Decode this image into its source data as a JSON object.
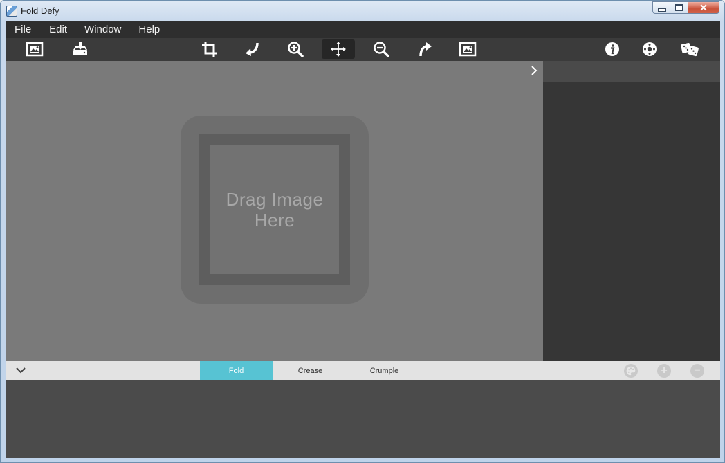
{
  "window": {
    "title": "Fold Defy",
    "close_glyph": "✕"
  },
  "menu": {
    "items": [
      "File",
      "Edit",
      "Window",
      "Help"
    ]
  },
  "toolbar": {
    "left": [
      {
        "name": "open-image-icon"
      },
      {
        "name": "save-download-icon"
      }
    ],
    "center": [
      {
        "name": "crop-icon"
      },
      {
        "name": "rotate-left-icon"
      },
      {
        "name": "zoom-in-icon"
      },
      {
        "name": "move-icon",
        "active": true
      },
      {
        "name": "zoom-out-icon"
      },
      {
        "name": "redo-icon"
      },
      {
        "name": "fit-image-icon"
      }
    ],
    "right": [
      {
        "name": "info-icon"
      },
      {
        "name": "settings-icon"
      },
      {
        "name": "random-dice-icon"
      }
    ]
  },
  "canvas": {
    "drop_hint": "Drag Image Here"
  },
  "tabs": {
    "items": [
      "Fold",
      "Crease",
      "Crumple"
    ],
    "active_index": 0
  },
  "bottom_buttons": {
    "palette_icon": "palette-icon",
    "add_label": "+",
    "remove_label": "−"
  },
  "colors": {
    "accent": "#57c3d3",
    "menubar": "#2e2e2e",
    "toolbar": "#3b3b3b",
    "canvas": "#7a7a7a",
    "sidepanel": "#363636"
  }
}
